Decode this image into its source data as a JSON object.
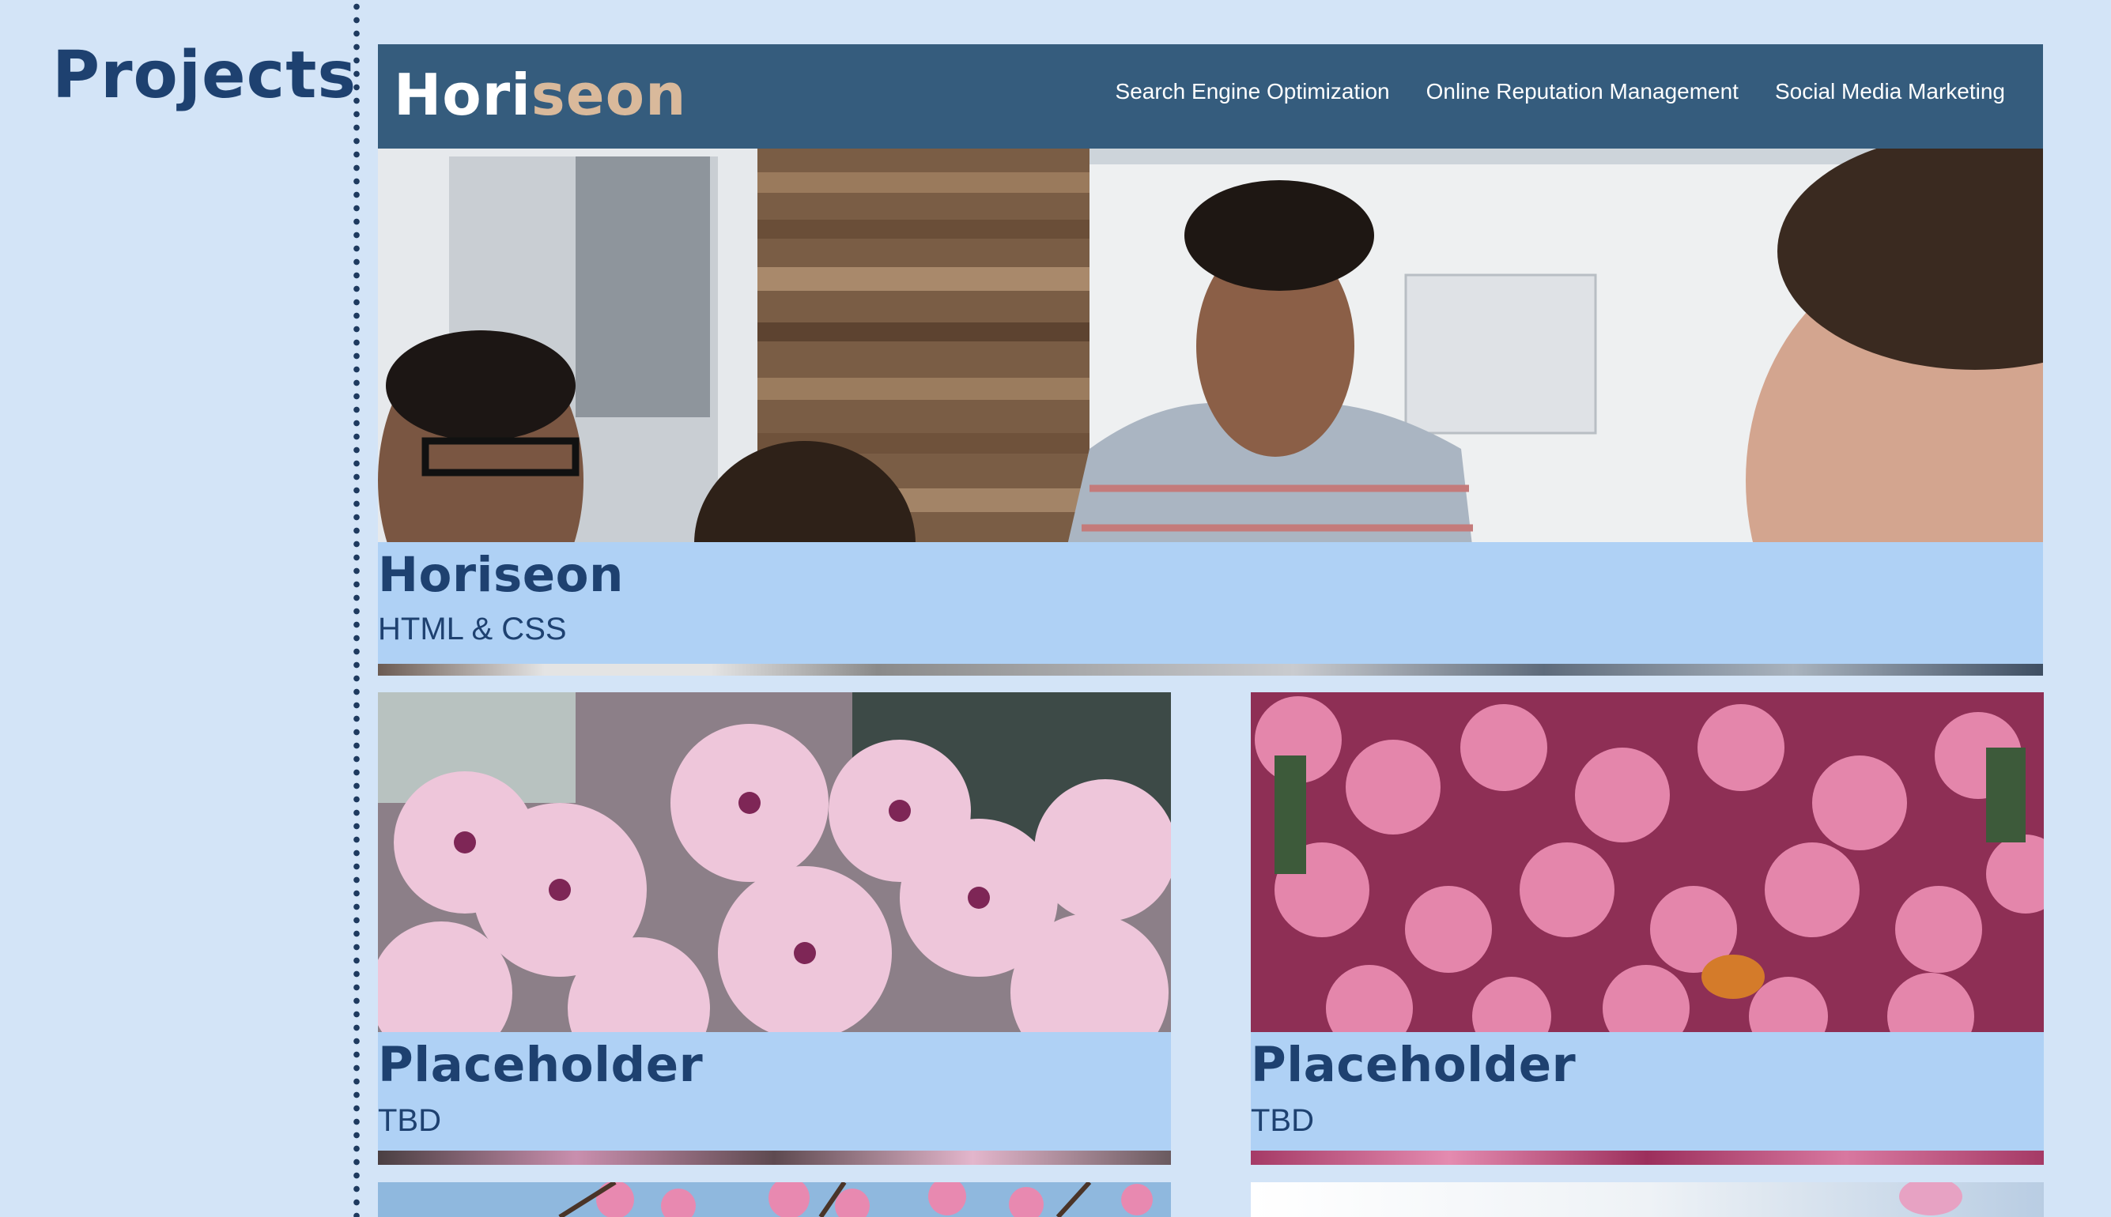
{
  "section": {
    "title": "Projects"
  },
  "featured": {
    "preview": {
      "logo_part1": "Hori",
      "logo_part2": "seon",
      "nav": [
        "Search Engine Optimization",
        "Online Reputation Management",
        "Social Media Marketing"
      ]
    },
    "title": "Horiseon",
    "subtitle": "HTML & CSS"
  },
  "projects": [
    {
      "title": "Placeholder",
      "subtitle": "TBD"
    },
    {
      "title": "Placeholder",
      "subtitle": "TBD"
    }
  ],
  "colors": {
    "background": "#d3e4f7",
    "accent_text": "#1e4170",
    "label_background": "#afd1f5",
    "header_background": "#355c7d",
    "logo_highlight": "#d9b99b"
  }
}
